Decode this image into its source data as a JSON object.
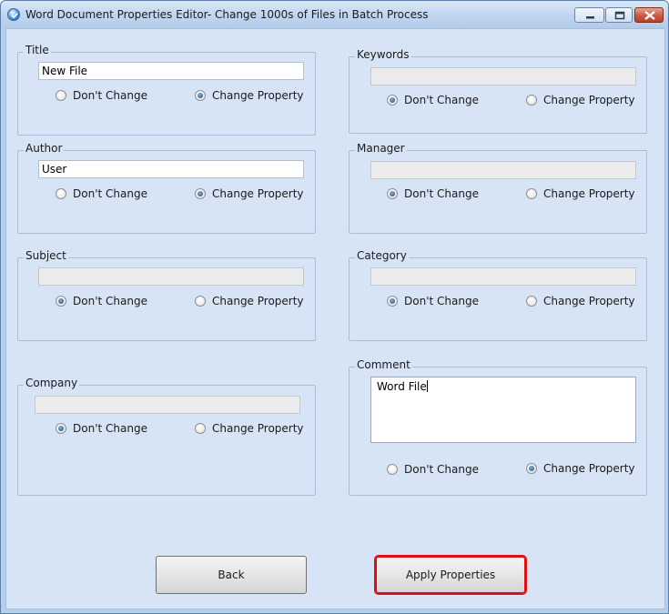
{
  "window": {
    "title": "Word Document Properties Editor- Change 1000s of Files in Batch Process"
  },
  "options": {
    "dont_change": "Don't Change",
    "change_property": "Change Property"
  },
  "groups": {
    "title": {
      "label": "Title",
      "value": "New File",
      "selected": "change"
    },
    "author": {
      "label": "Author",
      "value": "User",
      "selected": "change"
    },
    "subject": {
      "label": "Subject",
      "value": "",
      "selected": "dont"
    },
    "company": {
      "label": "Company",
      "value": "",
      "selected": "dont"
    },
    "keywords": {
      "label": "Keywords",
      "value": "",
      "selected": "dont"
    },
    "manager": {
      "label": "Manager",
      "value": "",
      "selected": "dont"
    },
    "category": {
      "label": "Category",
      "value": "",
      "selected": "dont"
    },
    "comment": {
      "label": "Comment",
      "value": "Word File",
      "selected": "change"
    }
  },
  "buttons": {
    "back": "Back",
    "apply": "Apply Properties"
  }
}
